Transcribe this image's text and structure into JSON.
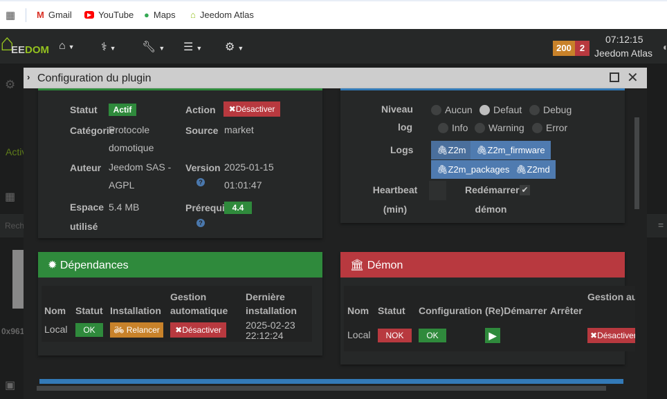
{
  "bookmarks": [
    {
      "label": "Gmail"
    },
    {
      "label": "YouTube"
    },
    {
      "label": "Maps"
    },
    {
      "label": "Jeedom Atlas"
    }
  ],
  "navbar": {
    "logo": "EEDOM",
    "counter_orange": "200",
    "counter_red": "2",
    "time": "07:12:15",
    "name": "Jeedom Atlas"
  },
  "background": {
    "active_text": "Activ",
    "search_placeholder": "Rech",
    "device_id": "0x961"
  },
  "modal": {
    "title": "Configuration du plugin",
    "info": {
      "statut_label": "Statut",
      "statut_value": "Actif",
      "action_label": "Action",
      "action_button": "Désactiver",
      "categorie_label": "Catégorie",
      "categorie_value": "Protocole domotique",
      "source_label": "Source",
      "source_value": "market",
      "auteur_label": "Auteur",
      "auteur_value": "Jeedom SAS - AGPL",
      "version_label": "Version",
      "version_value": "2025-01-15 01:01:47",
      "espace_label": "Espace utilisé",
      "espace_value": "5.4 MB",
      "prerequis_label": "Prérequis",
      "prerequis_value": "4.4"
    },
    "log": {
      "niveau_label": "Niveau log",
      "levels": [
        {
          "label": "Aucun",
          "selected": false
        },
        {
          "label": "Defaut",
          "selected": true
        },
        {
          "label": "Debug",
          "selected": false
        },
        {
          "label": "Info",
          "selected": false
        },
        {
          "label": "Warning",
          "selected": false
        },
        {
          "label": "Error",
          "selected": false
        }
      ],
      "logs_label": "Logs",
      "logs": [
        "Z2m",
        "Z2m_firmware",
        "Z2m_packages",
        "Z2md"
      ],
      "heartbeat_label": "Heartbeat (min)",
      "heartbeat_value": "",
      "restart_label": "Redémarrer démon",
      "restart_checked": true
    },
    "dependances": {
      "title": "Dépendances",
      "headers": [
        "Nom",
        "Statut",
        "Installation",
        "Gestion automatique",
        "Dernière installation"
      ],
      "row": {
        "nom": "Local",
        "statut": "OK",
        "installation": "Relancer",
        "gestion": "Désactiver",
        "derniere": "2025-02-23 22:12:24"
      }
    },
    "demon": {
      "title": "Démon",
      "headers": [
        "Nom",
        "Statut",
        "Configuration",
        "(Re)Démarrer",
        "Arrêter",
        "Gestion automatique"
      ],
      "row": {
        "nom": "Local",
        "statut": "NOK",
        "configuration": "OK",
        "gestion": "Désactiver"
      }
    }
  },
  "colors": {
    "green": "#2f8a3c",
    "red": "#b8393f",
    "orange": "#c8822a",
    "blue": "#337ab7",
    "logo_green": "#94c11f"
  }
}
